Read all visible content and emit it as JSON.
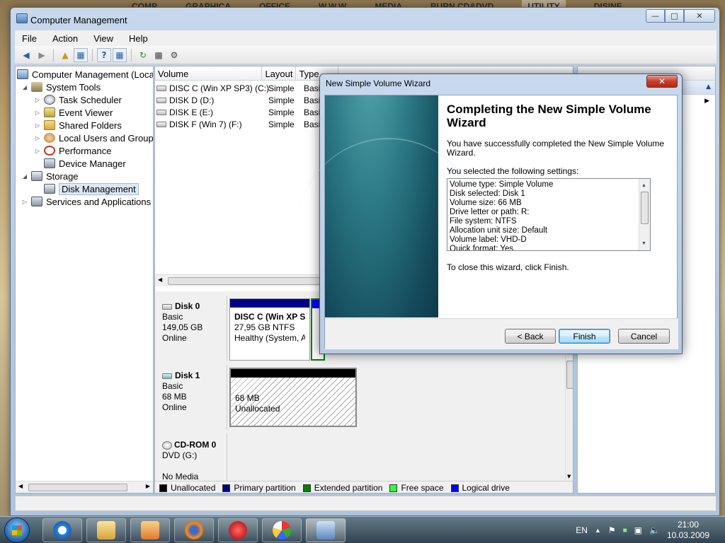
{
  "desktop_menu": [
    "COMP",
    "GRAPHICA",
    "OFFICE",
    "W.W.W",
    "MEDIA",
    "BURN CD&DVD",
    "UTILITY",
    "DISINE"
  ],
  "window": {
    "title": "Computer Management",
    "menu": [
      "File",
      "Action",
      "View",
      "Help"
    ]
  },
  "tree": {
    "root": "Computer Management (Local",
    "system_tools": "System Tools",
    "task_scheduler": "Task Scheduler",
    "event_viewer": "Event Viewer",
    "shared_folders": "Shared Folders",
    "local_users": "Local Users and Groups",
    "performance": "Performance",
    "device_manager": "Device Manager",
    "storage": "Storage",
    "disk_management": "Disk Management",
    "services_apps": "Services and Applications"
  },
  "volume_list": {
    "columns": [
      "Volume",
      "Layout",
      "Type"
    ],
    "rows": [
      {
        "volume": "DISC C (Win XP SP3) (C:)",
        "layout": "Simple",
        "type": "Basic"
      },
      {
        "volume": "DISK D (D:)",
        "layout": "Simple",
        "type": "Basic"
      },
      {
        "volume": "DISK E (E:)",
        "layout": "Simple",
        "type": "Basic"
      },
      {
        "volume": "DISK F (Win 7) (F:)",
        "layout": "Simple",
        "type": "Basic"
      }
    ]
  },
  "disks": [
    {
      "name": "Disk 0",
      "type": "Basic",
      "size": "149,05 GB",
      "status": "Online",
      "partition": {
        "name": "DISC C (Win XP SF",
        "size": "27,95 GB NTFS",
        "status": "Healthy (System, A"
      }
    },
    {
      "name": "Disk 1",
      "type": "Basic",
      "size": "68 MB",
      "status": "Online",
      "partition": {
        "size": "68 MB",
        "status": "Unallocated"
      }
    },
    {
      "name": "CD-ROM 0",
      "type": "DVD (G:)",
      "status": "No Media"
    }
  ],
  "legend": [
    {
      "label": "Unallocated",
      "color": "#000000"
    },
    {
      "label": "Primary partition",
      "color": "#00008b"
    },
    {
      "label": "Extended partition",
      "color": "#008000"
    },
    {
      "label": "Free space",
      "color": "#33ff33"
    },
    {
      "label": "Logical drive",
      "color": "#0000ff"
    }
  ],
  "dialog": {
    "title": "New Simple Volume Wizard",
    "heading": "Completing the New Simple Volume Wizard",
    "intro": "You have successfully completed the New Simple Volume Wizard.",
    "settings_label": "You selected the following settings:",
    "settings": [
      "Volume type: Simple Volume",
      "Disk selected: Disk 1",
      "Volume size: 66 MB",
      "Drive letter or path: R:",
      "File system: NTFS",
      "Allocation unit size: Default",
      "Volume label: VHD-D",
      "Quick format: Yes"
    ],
    "close_text": "To close this wizard, click Finish.",
    "back_label": "< Back",
    "finish_label": "Finish",
    "cancel_label": "Cancel"
  },
  "taskbar": {
    "lang": "EN",
    "time": "21:00",
    "date": "10.03.2009"
  }
}
